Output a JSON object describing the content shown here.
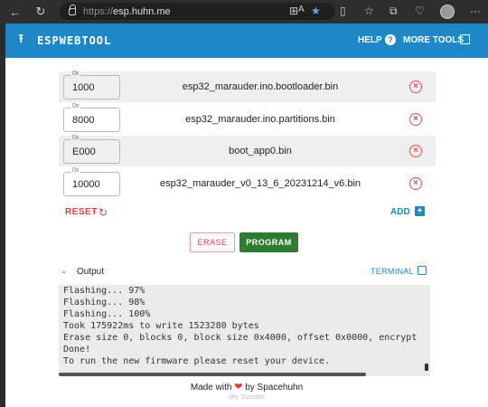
{
  "browser": {
    "url_prefix": "https://",
    "url_host": "esp.huhn.me"
  },
  "header": {
    "title": "ESPWEBTOOL",
    "help_label": "HELP",
    "more_tools_label": "MORE TOOLS"
  },
  "files": [
    {
      "offset_label": "0x",
      "offset": "1000",
      "filename": "esp32_marauder.ino.bootloader.bin"
    },
    {
      "offset_label": "0x",
      "offset": "8000",
      "filename": "esp32_marauder.ino.partitions.bin"
    },
    {
      "offset_label": "0x",
      "offset": "E000",
      "filename": "boot_app0.bin"
    },
    {
      "offset_label": "0x",
      "offset": "10000",
      "filename": "esp32_marauder_v0_13_6_20231214_v6.bin"
    }
  ],
  "actions": {
    "reset_label": "RESET",
    "add_label": "ADD",
    "erase_label": "ERASE",
    "program_label": "PROGRAM"
  },
  "output": {
    "title": "Output",
    "terminal_label": "TERMINAL",
    "lines": [
      "Flashing... 97%",
      "Flashing... 98%",
      "Flashing... 100%",
      "Took 175922ms to write 1523280 bytes",
      "Erase size 0, blocks 0, block size 0x4000, offset 0x0000, encrypt",
      "Done!",
      "To run the new firmware please reset your device."
    ]
  },
  "footer": {
    "made_with": "Made with",
    "by": "by Spacehuhn",
    "version": "dev 35ced0e"
  }
}
